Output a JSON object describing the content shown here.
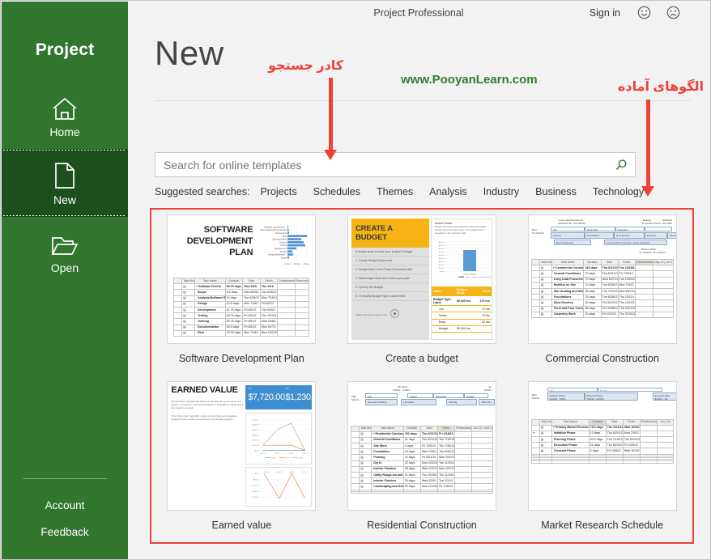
{
  "window": {
    "app_title": "Project Professional",
    "sign_in": "Sign in",
    "smile_icon": "smiley-face-icon",
    "frown_icon": "frowning-face-icon"
  },
  "sidebar": {
    "brand": "Project",
    "accent_color": "#31752f",
    "active_color": "#1d4f1d",
    "items": [
      {
        "label": "Home",
        "icon": "home-icon",
        "active": false
      },
      {
        "label": "New",
        "icon": "new-document-icon",
        "active": true
      },
      {
        "label": "Open",
        "icon": "open-folder-icon",
        "active": false
      }
    ],
    "bottom_links": [
      {
        "label": "Account"
      },
      {
        "label": "Feedback"
      }
    ]
  },
  "main": {
    "page_title": "New",
    "watermark": "www.PooyanLearn.com",
    "watermark_color": "#2f7d32",
    "search": {
      "placeholder": "Search for online templates",
      "value": "",
      "icon": "search-magnifier-icon"
    },
    "suggested": {
      "lead": "Suggested searches:",
      "items": [
        "Projects",
        "Schedules",
        "Themes",
        "Analysis",
        "Industry",
        "Business",
        "Technology"
      ]
    }
  },
  "annotations": {
    "color": "#ef4136",
    "search_label": "کادر جستجو",
    "templates_label": "الگوهای آماده"
  },
  "templates": [
    {
      "name": "Software Development Plan",
      "thumb_type": "software-dev-plan",
      "title_lines": [
        "SOFTWARE",
        "DEVELOPMENT",
        "PLAN"
      ],
      "chart": {
        "axis_ticks": [
          "0 days",
          "20 days",
          "40 days"
        ],
        "bars": [
          {
            "label": "Software development...",
            "value": 1
          },
          {
            "label": "Post Implementation Review",
            "value": 3
          },
          {
            "label": "Deployment",
            "value": 4
          },
          {
            "label": "Pilot",
            "value": 40
          },
          {
            "label": "Documentation",
            "value": 28
          },
          {
            "label": "Training",
            "value": 33
          },
          {
            "label": "Testing",
            "value": 37
          },
          {
            "label": "Development",
            "value": 19
          },
          {
            "label": "Design",
            "value": 11
          },
          {
            "label": "Analysis/Software...",
            "value": 12
          },
          {
            "label": "Scope",
            "value": 3
          }
        ]
      },
      "table": {
        "columns": [
          "Task Mode",
          "Task Name",
          "Duration",
          "Start",
          "Finish",
          "Predecessors",
          "Resource Names"
        ],
        "rows": [
          [
            "",
            "Software Develo",
            "93.75 days",
            "Wed 6/20,",
            "Thu 11/1/",
            "",
            ""
          ],
          [
            "",
            "Scope",
            "3.5 days",
            "Wed 6/20/1",
            "Tue 6/26/12",
            "",
            ""
          ],
          [
            "",
            "Analysis/Software Requirements",
            "14 days",
            "Tue 6/26/12",
            "Mon 7/16/12",
            "",
            ""
          ],
          [
            "",
            "Design",
            "14.5 days",
            "Mon 7/16/1",
            "Fri 8/3/12",
            "",
            ""
          ],
          [
            "",
            "Development",
            "21.75 days",
            "Fri 8/3/12",
            "Tue 9/4/12",
            "",
            ""
          ],
          [
            "",
            "Testing",
            "48.75 days",
            "Fri 8/3/12",
            "Thu 10/11/1",
            "",
            ""
          ],
          [
            "",
            "Training",
            "45.75 days",
            "Fri 8/3/12",
            "Mon 10/8/12",
            "",
            ""
          ],
          [
            "",
            "Documentation",
            "30.5 days",
            "Fri 8/3/12",
            "Mon 9/17/12",
            "",
            ""
          ],
          [
            "",
            "Pilot",
            "70.25 days",
            "Mon 7/16/1",
            "Mon 10/22/1",
            "",
            ""
          ]
        ]
      }
    },
    {
      "name": "Create a budget",
      "thumb_type": "create-budget",
      "heading": "CREATE A BUDGET",
      "steps": [
        "5 simple steps to track your project's budget",
        "1. Create Budget Resources",
        "2. Assign them to the Project Summary task",
        "3. Add Budget Work and Cost to your plan",
        "4. Specify the Budget",
        "5. Or modify Budget Type custom field"
      ],
      "watch_note": "Watch this demo to learn more",
      "note_title": "BUDGET WORK",
      "chart": {
        "y_ticks": [
          "$87 hrs",
          "$80 hrs",
          "$70 hrs",
          "$60 hrs",
          "$50 hrs",
          "$40 hrs",
          "$30 hrs",
          "$20 hrs",
          "$10 hrs",
          "$0 hrs"
        ],
        "y2_ticks": [
          "90,000 hrs",
          "80,000 hrs",
          "70,000 hrs",
          "60,000 hrs",
          "50,000 hrs",
          "40,000 hrs",
          "30,000 hrs",
          "20,000 hrs",
          "10,000 hrs",
          "0 hrs"
        ],
        "category": "Create a budget",
        "legend": [
          "Work",
          "Cost Budget Work"
        ],
        "value": 60
      },
      "table": {
        "columns": [
          "Name",
          "Budget Work",
          "Work"
        ],
        "rows": [
          [
            "Budget Type: Labor",
            "80,000 hrs",
            "176 hrs"
          ],
          [
            "Jon",
            "",
            "72 hrs"
          ],
          [
            "Sonia",
            "",
            "72 hrs"
          ],
          [
            "Brian",
            "",
            "32 hrs"
          ],
          [
            "Budget -",
            "80,000 hrs",
            ""
          ]
        ]
      }
    },
    {
      "name": "Commercial Construction",
      "thumb_type": "gantt",
      "timeline": {
        "callout_title": "Long Lead Procurement",
        "callout_dates": "Wed 6/27/12 - Tue 10/2/12",
        "right_labels": [
          "Heating",
          "Electrical"
        ],
        "right_dates": "Fri 12/ Mon 2/4/13 - Thu 4/25/",
        "start_label": "Start",
        "start_date": "Thu 6/21/12",
        "months": [
          "July",
          "September",
          "November",
          "January",
          "March"
        ],
        "bars": [
          {
            "label": "General",
            "sub": "Thu"
          },
          {
            "label": "Foundations",
            "sub": "Tue 8/28/12 - Thu"
          },
          {
            "label": "Steel Erection",
            "sub": "Fri 10/12/12 - Thu"
          },
          {
            "label": "Elevation",
            "sub": "Fri 11/30/12 - Thu"
          },
          {
            "label": "Carpen",
            "sub": "Fri"
          },
          {
            "label": "Site Grading and",
            "sub": "Tue 7/10/12 - Mon"
          },
          {
            "label": "Form and Pour Concrete - Floors and Roof",
            "sub": "Fri 10/26/12 - Thu 2/21/13"
          },
          {
            "label": "Masonry Work",
            "sub": "Fri 11/22/12 - Thu 4/25/13"
          }
        ]
      },
      "table": {
        "columns": [
          "Task Mode",
          "Task Name",
          "Duration",
          "Start",
          "Finish",
          "Predecessors",
          "May 13 Jun 1"
        ],
        "rows": [
          [
            "",
            "Commercial Construction",
            "344 days",
            "Thu 6/21/12",
            "Tue 10/15/13",
            "",
            ""
          ],
          [
            "",
            "General Conditions",
            "27 days",
            "Thu 6/21/12",
            "Fri 7/20/12",
            "",
            ""
          ],
          [
            "",
            "Long Lead Procurement",
            "70 days",
            "Wed 6/27/12",
            "Tue 10/2/12",
            "",
            ""
          ],
          [
            "",
            "Mobilize on Site",
            "10 days",
            "Tue 6/26/12",
            "Mon 7/9/12",
            "",
            ""
          ],
          [
            "",
            "Site Grading and Utilities",
            "35 days",
            "Tue 7/10/12",
            "Mon 8/27/12",
            "",
            ""
          ],
          [
            "",
            "Foundations",
            "33 days",
            "Tue 8/28/12",
            "Thu 10/11/1",
            "",
            ""
          ],
          [
            "",
            "Steel Erection",
            "40 days",
            "Fri 10/12/12",
            "Thu 12/13/1",
            "",
            ""
          ],
          [
            "",
            "Form and Pour Concrete - Floors and Roof",
            "85 days",
            "Fri 10/26/12",
            "Thu 2/21/13",
            "",
            ""
          ],
          [
            "",
            "Carpentry Work",
            "20 days",
            "Fri 2/22/13",
            "Thu 3/14/13",
            "",
            ""
          ]
        ]
      }
    },
    {
      "name": "Earned value",
      "thumb_type": "earned-value",
      "heading": "EARNED VALUE",
      "body": [
        "Earned value management helps you quantify the performance of a project. It compares costs and schedules to a baseline to determine if the project is on track.",
        "If the charts don't look right, make sure you have set a baseline, assigned costs to tasks or resources, and entered progress."
      ],
      "kpis": [
        {
          "label": "CPI",
          "value": "$7,720.00"
        },
        {
          "label": "SPI",
          "value": "$1,230.00"
        }
      ],
      "chart1": {
        "y_ticks": [
          "$6,000.00",
          "$5,000.00",
          "$4,000.00",
          "$3,000.00",
          "$2,000.00",
          "$1,000.00",
          "$0.00"
        ],
        "x_ticks": [
          "8/12/12",
          "8/19/12",
          "8/26/12",
          "9/2/12"
        ],
        "legend": [
          "ACWP",
          "BCWP",
          "BCWS"
        ],
        "series": [
          {
            "name": "ACWP",
            "color": "#4a90d9",
            "values": [
              0,
              0,
              0,
              0
            ]
          },
          {
            "name": "BCWP",
            "color": "#ed7d31",
            "values": [
              1200,
              1250,
              1250,
              0
            ]
          },
          {
            "name": "BCWS",
            "color": "#a5a5a5",
            "values": [
              1200,
              3200,
              5200,
              0
            ]
          }
        ]
      },
      "chart2": {
        "y_ticks": [
          "$0.00",
          "-$500.00",
          "-$1,000.00",
          "-$2,000.00",
          "-$3,000.00"
        ],
        "x_ticks": [
          "8/12/12",
          "8/19/12",
          "8/26/12",
          "9/2/12"
        ]
      }
    },
    {
      "name": "Residential Construction",
      "thumb_type": "gantt",
      "timeline": {
        "callout_title": "Site Work",
        "callout_dates": "7/20/12 - 7/26/12",
        "right_labels": [
          "Dr"
        ],
        "right_dates": "10/22/1",
        "start_label": "Start",
        "start_date": "6/21/12",
        "months": [
          "July",
          "August",
          "September",
          "October",
          "Nov"
        ],
        "bars": [
          {
            "label": "General Conditions",
            "sub": "6/21/12 - 7/20/12"
          },
          {
            "label": "Foundation",
            "sub": "7/25/12 - 8/20/12"
          },
          {
            "label": "Framing",
            "sub": "9/21/12 - 10/22/12"
          },
          {
            "label": "Utility Rou",
            "sub": "10/15/12"
          }
        ]
      },
      "table": {
        "columns": [
          "Task Mode",
          "Task Name",
          "Duration",
          "Start",
          "Finish",
          "Predecessors",
          "Jun 24, 12 | Jul 8, 12 | Aug 5"
        ],
        "rows": [
          [
            "",
            "Residential Construction",
            "152 days",
            "Thu 6/21/12",
            "Fri 1/18/13",
            "",
            ""
          ],
          [
            "",
            "General Conditions",
            "21 days",
            "Thu 6/21/12",
            "Thu 7/19/12",
            "",
            ""
          ],
          [
            "",
            "Site Work",
            "5 days",
            "Fri 7/20/12",
            "Thu 7/26/12",
            "",
            ""
          ],
          [
            "",
            "Foundation",
            "42 days",
            "Wed 7/25/1",
            "Thu 9/20/12",
            "",
            ""
          ],
          [
            "",
            "Framing",
            "22 days",
            "Fri 9/21/12",
            "Mon 10/22/1",
            "",
            ""
          ],
          [
            "",
            "Dry In",
            "22 days",
            "Mon 10/22/1",
            "Tue 11/20/1",
            "",
            ""
          ],
          [
            "",
            "Interior Finishes",
            "28 days",
            "Wed 11/21/1",
            "Mon 12/17/1",
            "",
            ""
          ],
          [
            "",
            "Utility Rough-ins and Concrete Concrete",
            "21 days",
            "Thu 10/25/12",
            "Thu 11/15/12",
            "",
            ""
          ],
          [
            "",
            "Interior Finishes",
            "30 days",
            "Wed 12/5/1",
            "Tue 1/1/13",
            "",
            ""
          ],
          [
            "",
            "Landscaping and Grounds Work",
            "20 days",
            "Mon 12/24/12",
            "Fri 1/18/13",
            "",
            ""
          ]
        ]
      }
    },
    {
      "name": "Market Research Schedule",
      "thumb_type": "gantt",
      "timeline": {
        "callout_title": "",
        "callout_dates": "",
        "right_labels": [
          "Execution Pha"
        ],
        "right_dates": "8/23/12 - 10/",
        "start_label": "Start",
        "start_date": "6/21/12",
        "months": [
          "July",
          "August"
        ],
        "bars": [
          {
            "label": "Initiation Phase",
            "sub": "6/21/12 - 7/9/12"
          },
          {
            "label": "Planning Phase",
            "sub": "7/10/12 - 8/23/12"
          },
          {
            "label": "Execution Pha",
            "sub": "8/23/12 - 10/"
          }
        ]
      },
      "table": {
        "columns": [
          "Task Mode",
          "Task Name",
          "Duration",
          "Start",
          "Finish",
          "Predecessors",
          "Jun Jul"
        ],
        "rows": [
          [
            "",
            "Primary Market Research Schedule",
            "79.5 days",
            "Thu 6/21/12",
            "Wed 10/10/12",
            "",
            ""
          ],
          [
            "",
            "Initiation Phase",
            "13 days",
            "Thu 6/21/12",
            "Mon 7/9/12",
            "",
            ""
          ],
          [
            "",
            "Planning Phase",
            "32.5 days",
            "Tue 7/10/12",
            "Thu 8/23/12",
            "",
            ""
          ],
          [
            "",
            "Execution Phase",
            "31 days",
            "Thu 8/23/12",
            "Fri 10/5/12",
            "",
            ""
          ],
          [
            "",
            "Closeout Phase",
            "3 days",
            "Fri 10/5/12",
            "Wed 10/10/12",
            "",
            ""
          ]
        ]
      }
    }
  ]
}
